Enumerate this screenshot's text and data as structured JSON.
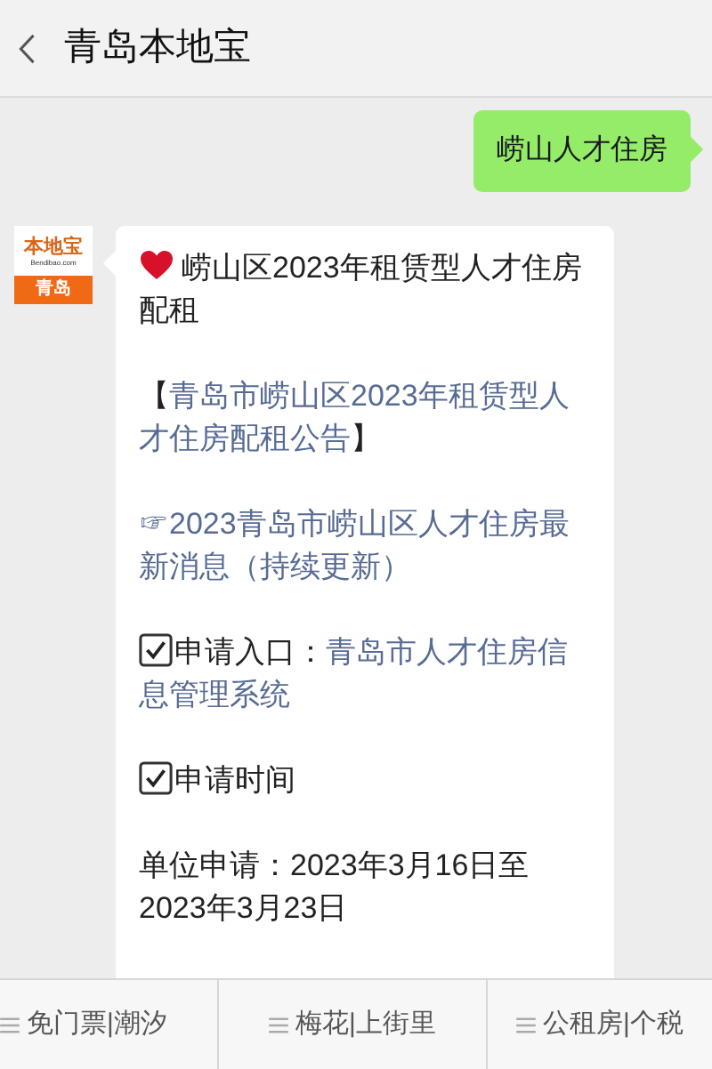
{
  "header": {
    "title": "青岛本地宝"
  },
  "messages": [
    {
      "kind": "sent",
      "text": "崂山人才住房"
    },
    {
      "kind": "received",
      "avatar": {
        "logo": "本地宝",
        "domain": "Bendibao.com",
        "city": "青岛"
      },
      "paragraphs": [
        {
          "kind": "title",
          "text": "崂山区2023年租赁型人才住房配租"
        },
        {
          "kind": "bracket_link",
          "open": "【",
          "link": "青岛市崂山区2023年租赁型人才住房配租公告",
          "close": "】"
        },
        {
          "kind": "link",
          "text": "☞2023青岛市崂山区人才住房最新消息（持续更新）"
        },
        {
          "kind": "check",
          "text": "申请入口：",
          "link": "青岛市人才住房信息管理系统"
        },
        {
          "kind": "check",
          "text": "申请时间"
        },
        {
          "kind": "plain",
          "text": "单位申请：2023年3月16日至2023年3月23日"
        }
      ]
    }
  ],
  "menu": [
    {
      "label": "免门票|潮汐"
    },
    {
      "label": "梅花|上街里"
    },
    {
      "label": "公租房|个税"
    }
  ]
}
